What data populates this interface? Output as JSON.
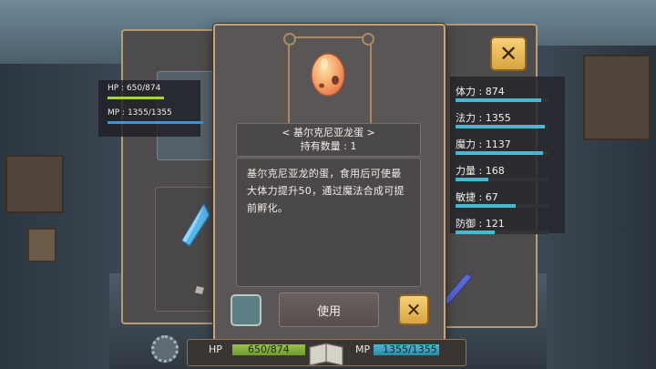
{
  "stats_left": {
    "hp_label": "HP : 650/874",
    "mp_label": "MP : 1355/1355",
    "hp_ratio": 0.744,
    "mp_ratio": 1.0
  },
  "item": {
    "name": "< 基尔克尼亚龙蛋 >",
    "quantity": "持有数量 : 1",
    "description": "基尔克尼亚龙的蛋，食用后可使最大体力提升50，通过魔法合成可提前孵化。",
    "use_label": "使用"
  },
  "attributes": [
    {
      "label": "体力 : 874",
      "ratio": 0.92
    },
    {
      "label": "法力 : 1355",
      "ratio": 0.96
    },
    {
      "label": "魔力 : 1137",
      "ratio": 0.94
    },
    {
      "label": "力量 : 168",
      "ratio": 0.35
    },
    {
      "label": "敏捷 : 67",
      "ratio": 0.65
    },
    {
      "label": "防御 : 121",
      "ratio": 0.42
    }
  ],
  "hud": {
    "hp_label": "HP",
    "hp_value": "650/874",
    "mp_label": "MP",
    "mp_value": "1355/1355"
  },
  "icons": {
    "close": "close-icon",
    "egg": "dragon-egg-icon",
    "gear": "gear-icon",
    "book": "book-icon",
    "crystal": "crystal-icon"
  },
  "colors": {
    "hp_bar": "#9ac24b",
    "mp_bar": "#3b93d8",
    "attr_bar": "#48b9cf",
    "accent_gold": "#d9a540"
  }
}
